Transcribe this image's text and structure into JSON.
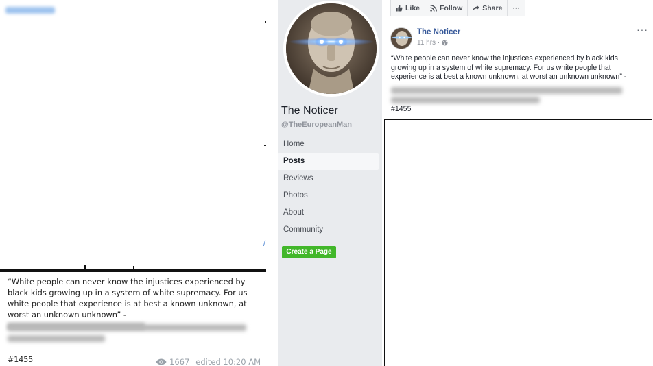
{
  "left_post": {
    "quote_text": "“White people can never know the injustices experienced by black kids growing up in a system of white supremacy. For us white people that experience is at best a known unknown, at worst an unknown unknown” -",
    "hashtag": "#1455",
    "views": "1667",
    "edited": "edited 10:20 AM",
    "eye_icon": "eye-icon"
  },
  "fb_page": {
    "name": "The Noticer",
    "handle": "@TheEuropeanMan",
    "nav": [
      "Home",
      "Posts",
      "Reviews",
      "Photos",
      "About",
      "Community"
    ],
    "active_nav": "Posts",
    "create_page_label": "Create a Page"
  },
  "fb_actions": {
    "like_label": "Like",
    "follow_label": "Follow",
    "share_label": "Share",
    "more_label": "···"
  },
  "fb_post": {
    "author": "The Noticer",
    "time": "11 hrs ·",
    "menu_label": "···",
    "text": "“White people can never know the injustices experienced by black kids growing up in a system of white supremacy. For us white people that experience is at best a known unknown, at worst an unknown unknown” -",
    "hashtag": "#1455"
  },
  "colors": {
    "fb_link": "#365899",
    "fb_sidebar_bg": "#e9ebee",
    "create_button": "#42b72a",
    "meta_gray": "#9aa2aa"
  }
}
